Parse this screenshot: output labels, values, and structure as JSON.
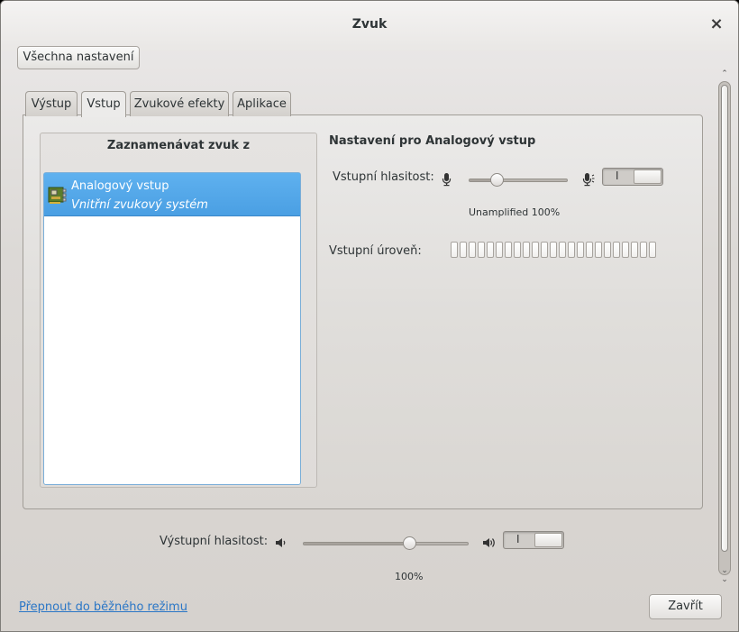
{
  "window": {
    "title": "Zvuk"
  },
  "toolbar": {
    "all_settings_label": "Všechna nastavení"
  },
  "tabs": [
    {
      "label": "Výstup",
      "active": false
    },
    {
      "label": "Vstup",
      "active": true
    },
    {
      "label": "Zvukové efekty",
      "active": false
    },
    {
      "label": "Aplikace",
      "active": false
    }
  ],
  "input_tab": {
    "device_heading": "Zaznamenávat zvuk z",
    "devices": [
      {
        "name": "Analogový vstup",
        "description": "Vnitřní zvukový systém",
        "selected": true,
        "icon": "sound-card-icon"
      }
    ],
    "settings_heading": "Nastavení pro Analogový vstup",
    "input_volume_label": "Vstupní hlasitost:",
    "input_volume_value": "Unamplified 100%",
    "input_volume_fraction": 0.29,
    "input_switch_on_label": "I",
    "input_level_label": "Vstupní úroveň:",
    "input_level_segments": 23,
    "input_level_fraction": 0
  },
  "output": {
    "volume_label": "Výstupní hlasitost:",
    "volume_value": "100%",
    "volume_fraction": 0.65,
    "switch_on_label": "I"
  },
  "footer": {
    "mode_link": "Přepnout do běžného režimu",
    "close_label": "Zavřít"
  },
  "colors": {
    "selection": "#4a9fe3",
    "link": "#2a76c6"
  }
}
